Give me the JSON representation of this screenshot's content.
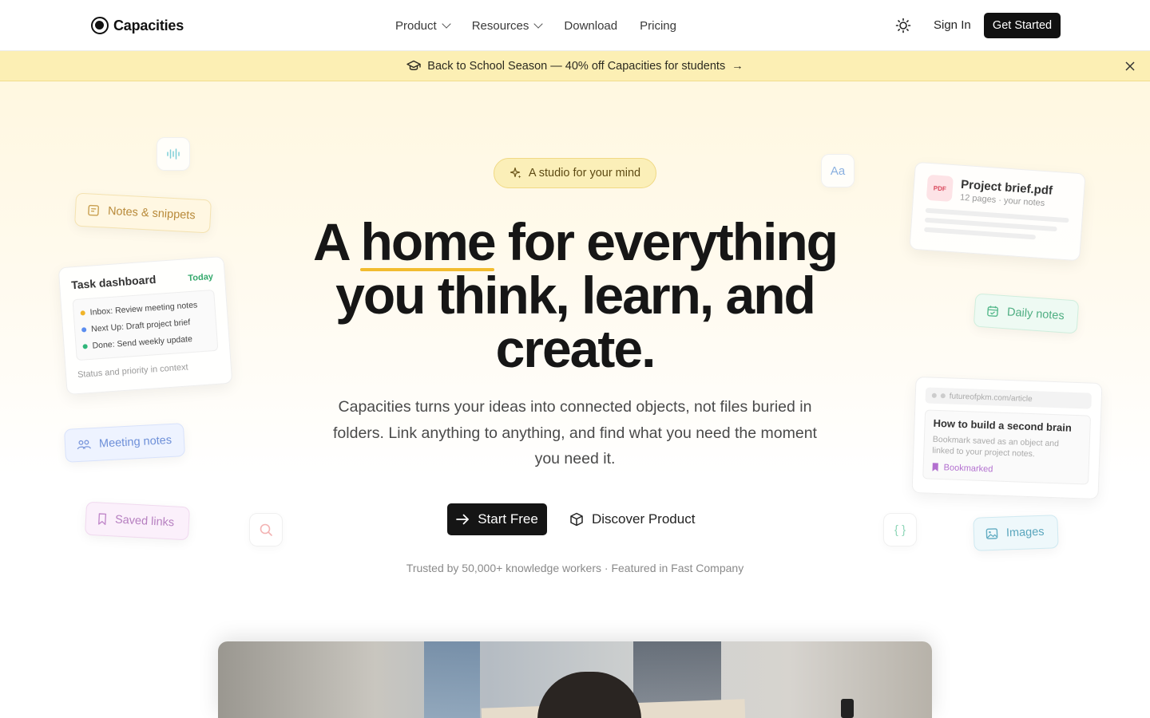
{
  "nav": {
    "logo_text": "Capacities",
    "links": [
      {
        "label": "Product",
        "has_dropdown": true
      },
      {
        "label": "Resources",
        "has_dropdown": true
      },
      {
        "label": "Download",
        "has_dropdown": false
      },
      {
        "label": "Pricing",
        "has_dropdown": false
      }
    ],
    "theme_icon": "sun-icon",
    "sign_in": "Sign In",
    "get_started": "Get Started"
  },
  "banner": {
    "icon": "graduation-cap-icon",
    "text": "Back to School Season — 40% off Capacities for students",
    "arrow": "→",
    "close_icon": "close-icon",
    "background": "#fcefb4"
  },
  "hero": {
    "pill_text": "A studio for your mind",
    "pill_icon": "sparkle-icon",
    "headline_lines": [
      "A home for everything",
      "you think, learn, and",
      "create."
    ],
    "subcopy": "Capacities turns your ideas into connected objects, not files buried in folders. Link anything to anything, and find what you need the moment you need it.",
    "cta_primary": "Start Free",
    "cta_secondary": "Discover Product",
    "trust": "Trusted by 50,000+ knowledge workers · Featured in Fast Company",
    "accent": "#f2bc2f"
  },
  "floating": {
    "notes_snippets": "Notes & snippets",
    "task_dashboard": {
      "title": "Task dashboard",
      "badge": "Today",
      "items": [
        {
          "text": "Inbox: Review meeting notes",
          "color": "#f0b429"
        },
        {
          "text": "Next Up: Draft project brief",
          "color": "#5b8def"
        },
        {
          "text": "Done: Send weekly update",
          "color": "#2fb67a"
        }
      ],
      "footer": "Status and priority in context"
    },
    "meeting_notes": "Meeting notes",
    "saved_links": "Saved links",
    "pdf": {
      "badge": "PDF",
      "name": "Project brief.pdf",
      "meta": "12 pages · your notes"
    },
    "daily_notes": "Daily notes",
    "bookmark": {
      "url": "futureofpkm.com/article",
      "title": "How to build a second brain",
      "desc": "Bookmark saved as an object and linked to your project notes.",
      "badge": "Bookmarked"
    },
    "images": "Images",
    "font_tile_text": "Aa"
  }
}
